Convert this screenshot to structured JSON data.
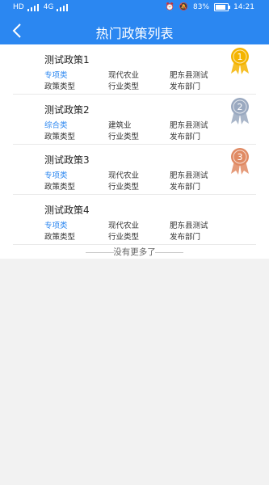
{
  "status_bar": {
    "left_labels": [
      "HD",
      "4G"
    ],
    "battery_text": "83%",
    "time": "14:21",
    "battery_level": 0.83
  },
  "nav": {
    "title": "热门政策列表",
    "back_icon": "chevron-left-icon"
  },
  "columns": {
    "type_label": "政策类型",
    "industry_label": "行业类型",
    "dept_label": "发布部门"
  },
  "policies": [
    {
      "name": "测试政策1",
      "type": "专项类",
      "industry": "现代农业",
      "dept": "肥东县测试",
      "medal": "1",
      "medal_color": "#f4b400"
    },
    {
      "name": "测试政策2",
      "type": "综合类",
      "industry": "建筑业",
      "dept": "肥东县测试",
      "medal": "2",
      "medal_color": "#9aa9c0"
    },
    {
      "name": "测试政策3",
      "type": "专项类",
      "industry": "现代农业",
      "dept": "肥东县测试",
      "medal": "3",
      "medal_color": "#e08a63"
    },
    {
      "name": "测试政策4",
      "type": "专项类",
      "industry": "现代农业",
      "dept": "肥东县测试",
      "medal": "",
      "medal_color": ""
    }
  ],
  "footer": {
    "no_more": "没有更多了"
  },
  "colors": {
    "header": "#2b87f1",
    "type_text": "#2b87f1"
  }
}
